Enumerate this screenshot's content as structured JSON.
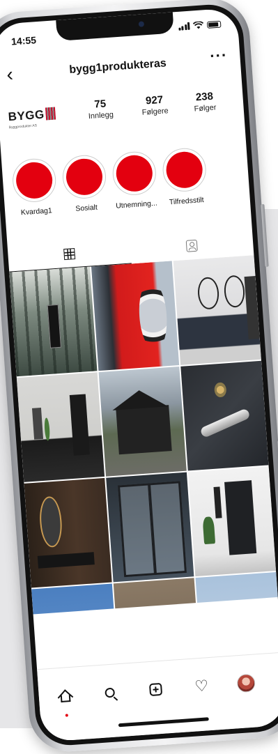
{
  "status_bar": {
    "time": "14:55"
  },
  "profile": {
    "username": "bygg1produkteras",
    "logo_text": "BYGG",
    "logo_subtitle": "Byggprodukter AS",
    "stats": [
      {
        "value": "75",
        "label": "Innlegg"
      },
      {
        "value": "927",
        "label": "Følgere"
      },
      {
        "value": "238",
        "label": "Følger"
      }
    ]
  },
  "highlights": [
    {
      "label": "Kvardag1"
    },
    {
      "label": "Sosialt"
    },
    {
      "label": "Utnemning..."
    },
    {
      "label": "Tilfredsstilt"
    }
  ],
  "tabs": [
    {
      "name": "grid-icon",
      "active": true
    },
    {
      "name": "tagged-icon",
      "active": false
    }
  ],
  "grid_posts": [
    {
      "subject": "forest-doorway"
    },
    {
      "subject": "red-washing-machine-door"
    },
    {
      "subject": "bathroom-vanity"
    },
    {
      "subject": "kitchen-interior-black-door"
    },
    {
      "subject": "black-cabin-mountains"
    },
    {
      "subject": "door-handle-closeup"
    },
    {
      "subject": "dark-bathroom-mirror"
    },
    {
      "subject": "glass-double-doors"
    },
    {
      "subject": "entrance-black-door"
    },
    {
      "subject": "blue-wall"
    },
    {
      "subject": "wood-floor"
    },
    {
      "subject": "light-blue-interior"
    }
  ],
  "bottom_nav": [
    {
      "name": "home-icon"
    },
    {
      "name": "search-icon"
    },
    {
      "name": "new-post-icon"
    },
    {
      "name": "heart-icon"
    },
    {
      "name": "profile-avatar"
    }
  ],
  "colors": {
    "highlight_red": "#e3000f",
    "background_band": "#e6e6e8"
  }
}
